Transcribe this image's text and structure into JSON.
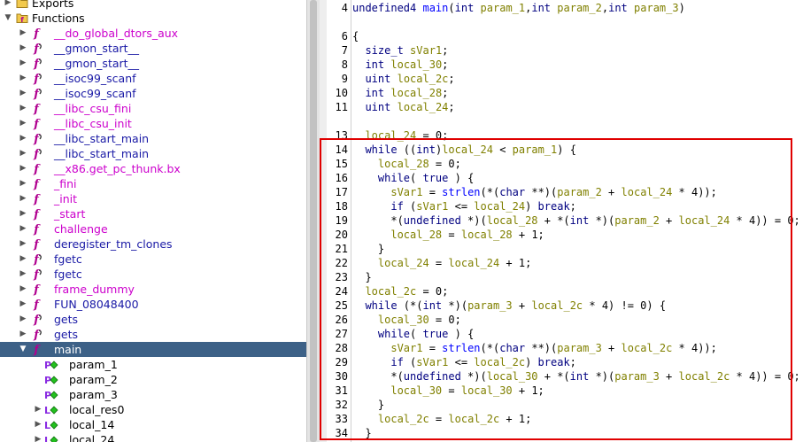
{
  "symbol_tree": {
    "items": [
      {
        "label": "Exports",
        "type": "folder",
        "indent": 0,
        "arrow": "right",
        "color": "plain"
      },
      {
        "label": "Functions",
        "type": "folder-f",
        "indent": 0,
        "arrow": "down",
        "color": "plain"
      },
      {
        "label": "__do_global_dtors_aux",
        "type": "func",
        "indent": 1,
        "arrow": "right",
        "color": "purple"
      },
      {
        "label": "__gmon_start__",
        "type": "thunk",
        "indent": 1,
        "arrow": "right",
        "color": "blue"
      },
      {
        "label": "__gmon_start__",
        "type": "thunk",
        "indent": 1,
        "arrow": "right",
        "color": "blue"
      },
      {
        "label": "__isoc99_scanf",
        "type": "thunk",
        "indent": 1,
        "arrow": "right",
        "color": "blue"
      },
      {
        "label": "__isoc99_scanf",
        "type": "thunk",
        "indent": 1,
        "arrow": "right",
        "color": "blue"
      },
      {
        "label": "__libc_csu_fini",
        "type": "func",
        "indent": 1,
        "arrow": "right",
        "color": "purple"
      },
      {
        "label": "__libc_csu_init",
        "type": "func",
        "indent": 1,
        "arrow": "right",
        "color": "purple"
      },
      {
        "label": "__libc_start_main",
        "type": "thunk",
        "indent": 1,
        "arrow": "right",
        "color": "blue"
      },
      {
        "label": "__libc_start_main",
        "type": "thunk",
        "indent": 1,
        "arrow": "right",
        "color": "blue"
      },
      {
        "label": "__x86.get_pc_thunk.bx",
        "type": "func",
        "indent": 1,
        "arrow": "right",
        "color": "purple"
      },
      {
        "label": "_fini",
        "type": "func",
        "indent": 1,
        "arrow": "right",
        "color": "purple"
      },
      {
        "label": "_init",
        "type": "func",
        "indent": 1,
        "arrow": "right",
        "color": "purple"
      },
      {
        "label": "_start",
        "type": "func",
        "indent": 1,
        "arrow": "right",
        "color": "purple"
      },
      {
        "label": "challenge",
        "type": "func",
        "indent": 1,
        "arrow": "right",
        "color": "purple"
      },
      {
        "label": "deregister_tm_clones",
        "type": "func",
        "indent": 1,
        "arrow": "right",
        "color": "blue"
      },
      {
        "label": "fgetc",
        "type": "thunk",
        "indent": 1,
        "arrow": "right",
        "color": "blue"
      },
      {
        "label": "fgetc",
        "type": "thunk",
        "indent": 1,
        "arrow": "right",
        "color": "blue"
      },
      {
        "label": "frame_dummy",
        "type": "func",
        "indent": 1,
        "arrow": "right",
        "color": "purple"
      },
      {
        "label": "FUN_08048400",
        "type": "func",
        "indent": 1,
        "arrow": "right",
        "color": "blue"
      },
      {
        "label": "gets",
        "type": "thunk",
        "indent": 1,
        "arrow": "right",
        "color": "blue"
      },
      {
        "label": "gets",
        "type": "thunk",
        "indent": 1,
        "arrow": "right",
        "color": "blue"
      },
      {
        "label": "main",
        "type": "func",
        "indent": 1,
        "arrow": "down",
        "color": "purple",
        "selected": true
      },
      {
        "label": "param_1",
        "type": "param",
        "indent": 2,
        "arrow": "none",
        "color": "plain"
      },
      {
        "label": "param_2",
        "type": "param",
        "indent": 2,
        "arrow": "none",
        "color": "plain"
      },
      {
        "label": "param_3",
        "type": "param",
        "indent": 2,
        "arrow": "none",
        "color": "plain"
      },
      {
        "label": "local_res0",
        "type": "local",
        "indent": 2,
        "arrow": "right",
        "color": "plain"
      },
      {
        "label": "local_14",
        "type": "local",
        "indent": 2,
        "arrow": "right",
        "color": "plain"
      },
      {
        "label": "local_24",
        "type": "local",
        "indent": 2,
        "arrow": "right",
        "color": "plain"
      }
    ]
  },
  "decompiler": {
    "lines": [
      {
        "n": "4",
        "code": "undefined4 main(int param_1,int param_2,int param_3)"
      },
      {
        "n": "",
        "code": ""
      },
      {
        "n": "6",
        "code": "{"
      },
      {
        "n": "7",
        "code": "  size_t sVar1;"
      },
      {
        "n": "8",
        "code": "  int local_30;"
      },
      {
        "n": "9",
        "code": "  uint local_2c;"
      },
      {
        "n": "10",
        "code": "  int local_28;"
      },
      {
        "n": "11",
        "code": "  uint local_24;"
      },
      {
        "n": "",
        "code": ""
      },
      {
        "n": "13",
        "code": "  local_24 = 0;"
      },
      {
        "n": "14",
        "code": "  while ((int)local_24 < param_1) {"
      },
      {
        "n": "15",
        "code": "    local_28 = 0;"
      },
      {
        "n": "16",
        "code": "    while( true ) {"
      },
      {
        "n": "17",
        "code": "      sVar1 = strlen(*(char **)(param_2 + local_24 * 4));"
      },
      {
        "n": "18",
        "code": "      if (sVar1 <= local_24) break;"
      },
      {
        "n": "19",
        "code": "      *(undefined *)(local_28 + *(int *)(param_2 + local_24 * 4)) = 0;"
      },
      {
        "n": "20",
        "code": "      local_28 = local_28 + 1;"
      },
      {
        "n": "21",
        "code": "    }"
      },
      {
        "n": "22",
        "code": "    local_24 = local_24 + 1;"
      },
      {
        "n": "23",
        "code": "  }"
      },
      {
        "n": "24",
        "code": "  local_2c = 0;"
      },
      {
        "n": "25",
        "code": "  while (*(int *)(param_3 + local_2c * 4) != 0) {"
      },
      {
        "n": "26",
        "code": "    local_30 = 0;"
      },
      {
        "n": "27",
        "code": "    while( true ) {"
      },
      {
        "n": "28",
        "code": "      sVar1 = strlen(*(char **)(param_3 + local_2c * 4));"
      },
      {
        "n": "29",
        "code": "      if (sVar1 <= local_2c) break;"
      },
      {
        "n": "30",
        "code": "      *(undefined *)(local_30 + *(int *)(param_3 + local_2c * 4)) = 0;"
      },
      {
        "n": "31",
        "code": "      local_30 = local_30 + 1;"
      },
      {
        "n": "32",
        "code": "    }"
      },
      {
        "n": "33",
        "code": "    local_2c = local_2c + 1;"
      },
      {
        "n": "34",
        "code": "  }"
      }
    ]
  },
  "colors": {
    "keyword": "#000080",
    "function_call": "#0000ff",
    "variable": "#808000",
    "selection": "#3d6187",
    "highlight_box": "#e00000"
  }
}
